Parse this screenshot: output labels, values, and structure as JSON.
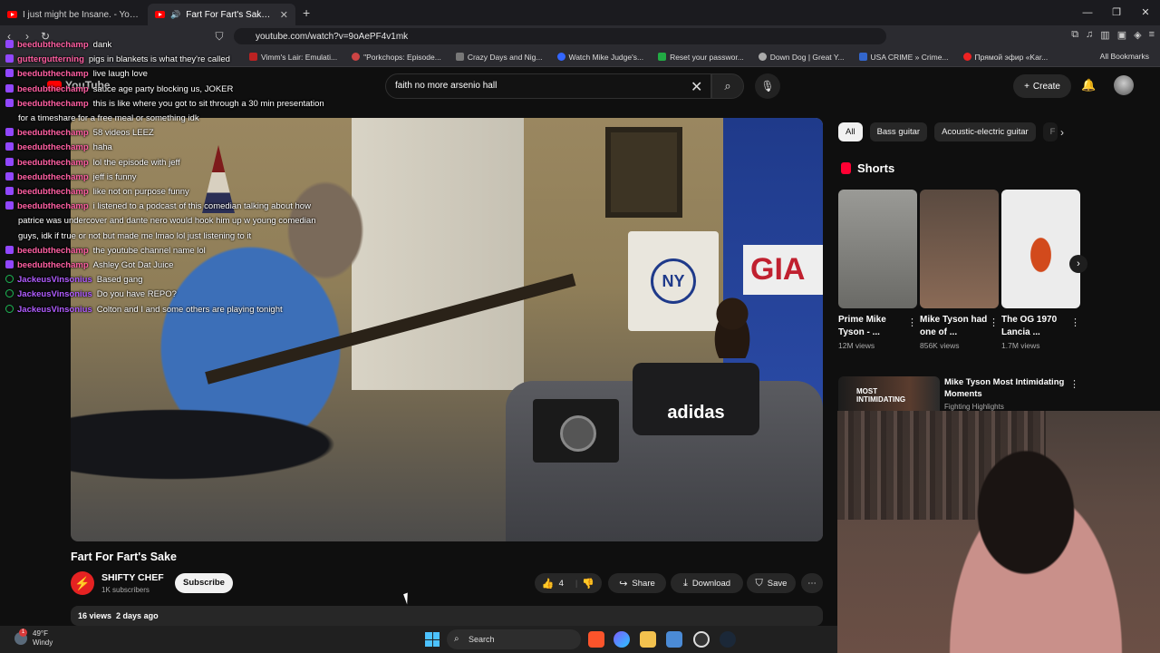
{
  "browser": {
    "tabs": [
      {
        "title": "I just might be Insane. - YouTube",
        "active": false
      },
      {
        "title": "Fart For Fart's Sake - YouTube",
        "active": true
      }
    ],
    "url": "youtube.com/watch?v=9oAePF4v1mk",
    "bookmarks": [
      "Vimm's Lair: Emulati...",
      "\"Porkchops: Episode...",
      "Crazy Days and Nig...",
      "Watch Mike Judge's...",
      "Reset your passwor...",
      "Down Dog | Great Y...",
      "USA CRIME » Crime...",
      "Прямой эфир «Kar..."
    ],
    "all_bookmarks": "All Bookmarks"
  },
  "youtube": {
    "logo": "YouTube",
    "search_query": "faith no more arsenio hall",
    "create_label": "Create"
  },
  "chat": [
    {
      "user": "beedubthechamp",
      "msg": "dank",
      "badge": "purple"
    },
    {
      "user": "guttergutterning",
      "msg": "pigs in blankets is what they're called",
      "badge": "purple"
    },
    {
      "user": "beedubthechamp",
      "msg": "live laugh love",
      "badge": "purple"
    },
    {
      "user": "beedubthechamp",
      "msg": "sauce age party blocking us, JOKER",
      "badge": "purple"
    },
    {
      "user": "beedubthechamp",
      "msg": "this is like where you got to sit through a 30 min presentation",
      "badge": "purple"
    },
    {
      "user": "",
      "msg": "for a timeshare for a free meal or something idk",
      "badge": ""
    },
    {
      "user": "beedubthechamp",
      "msg": "58 videos LEEZ",
      "badge": "purple"
    },
    {
      "user": "beedubthechamp",
      "msg": "haha",
      "badge": "purple"
    },
    {
      "user": "beedubthechamp",
      "msg": "lol the episode with jeff",
      "badge": "purple"
    },
    {
      "user": "beedubthechamp",
      "msg": "jeff is funny",
      "badge": "purple"
    },
    {
      "user": "beedubthechamp",
      "msg": "like not on purpose funny",
      "badge": "purple"
    },
    {
      "user": "beedubthechamp",
      "msg": "i listened to a podcast of this comedian talking about how",
      "badge": "purple"
    },
    {
      "user": "",
      "msg": "patrice was undercover and dante nero would hook him up w young comedian",
      "badge": ""
    },
    {
      "user": "",
      "msg": "guys, idk if true or not but made me lmao lol just listening to it",
      "badge": ""
    },
    {
      "user": "beedubthechamp",
      "msg": "the youtube channel name lol",
      "badge": "purple"
    },
    {
      "user": "beedubthechamp",
      "msg": "Ashley Got Dat Juice",
      "badge": "purple"
    },
    {
      "user": "JackeusVinsonius",
      "msg": "Based gang",
      "badge": "green"
    },
    {
      "user": "JackeusVinsonius",
      "msg": "Do you have REPO?",
      "badge": "green"
    },
    {
      "user": "JackeusVinsonius",
      "msg": "Colton and I and some others are playing tonight",
      "badge": "green"
    }
  ],
  "video": {
    "flag_text": "GIA",
    "poster_text": "NY",
    "bag_text": "adidas",
    "title": "Fart For Fart's Sake",
    "channel": "SHIFTY CHEF",
    "subscribers": "1K subscribers",
    "subscribe_label": "Subscribe",
    "likes": "4",
    "share_label": "Share",
    "download_label": "Download",
    "save_label": "Save",
    "views": "16 views",
    "age": "2 days ago"
  },
  "sidebar": {
    "chips": [
      "All",
      "Bass guitar",
      "Acoustic-electric guitar",
      "F"
    ],
    "shorts_heading": "Shorts",
    "shorts": [
      {
        "title": "Prime Mike Tyson - ...",
        "views": "12M views",
        "color": "#8a8a86"
      },
      {
        "title": "Mike Tyson had one of ...",
        "views": "856K views",
        "color": "#6b5a4c"
      },
      {
        "title": "The OG 1970 Lancia ...",
        "views": "1.7M views",
        "color": "#e8e8e8"
      }
    ],
    "recommended": {
      "title": "Mike Tyson Most Intimidating Moments",
      "channel": "Fighting Highlights",
      "thumb_text": "MOST INTIMIDATING"
    }
  },
  "taskbar": {
    "temperature": "49°F",
    "weather": "Windy",
    "search_placeholder": "Search"
  }
}
